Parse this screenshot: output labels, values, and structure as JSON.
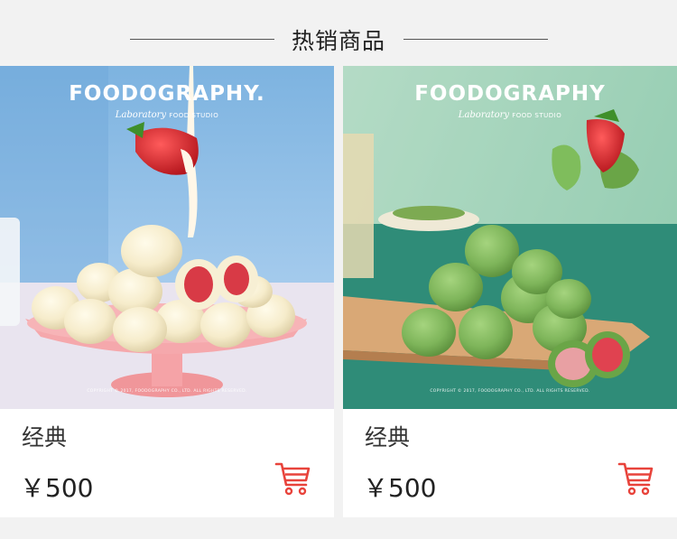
{
  "section": {
    "title": "热销商品"
  },
  "products": [
    {
      "name": "经典",
      "price": "￥500",
      "image": {
        "brand": "FOODOGRAPHY.",
        "sub_italic": "Laboratory",
        "sub_studio": "FOOD STUDIO",
        "copyright": "COPYRIGHT © 2017, FOODOGRAPHY CO., LTD. ALL RIGHTS RESERVED."
      }
    },
    {
      "name": "经典",
      "price": "￥500",
      "image": {
        "brand": "FOODOGRAPHY",
        "sub_italic": "Laboratory",
        "sub_studio": "FOOD STUDIO",
        "copyright": "COPYRIGHT © 2017, FOODOGRAPHY CO., LTD. ALL RIGHTS RESERVED."
      }
    }
  ],
  "icons": {
    "cart": "shopping-cart-icon"
  },
  "colors": {
    "accent": "#e8433b",
    "background": "#f2f2f2",
    "card": "#ffffff"
  }
}
